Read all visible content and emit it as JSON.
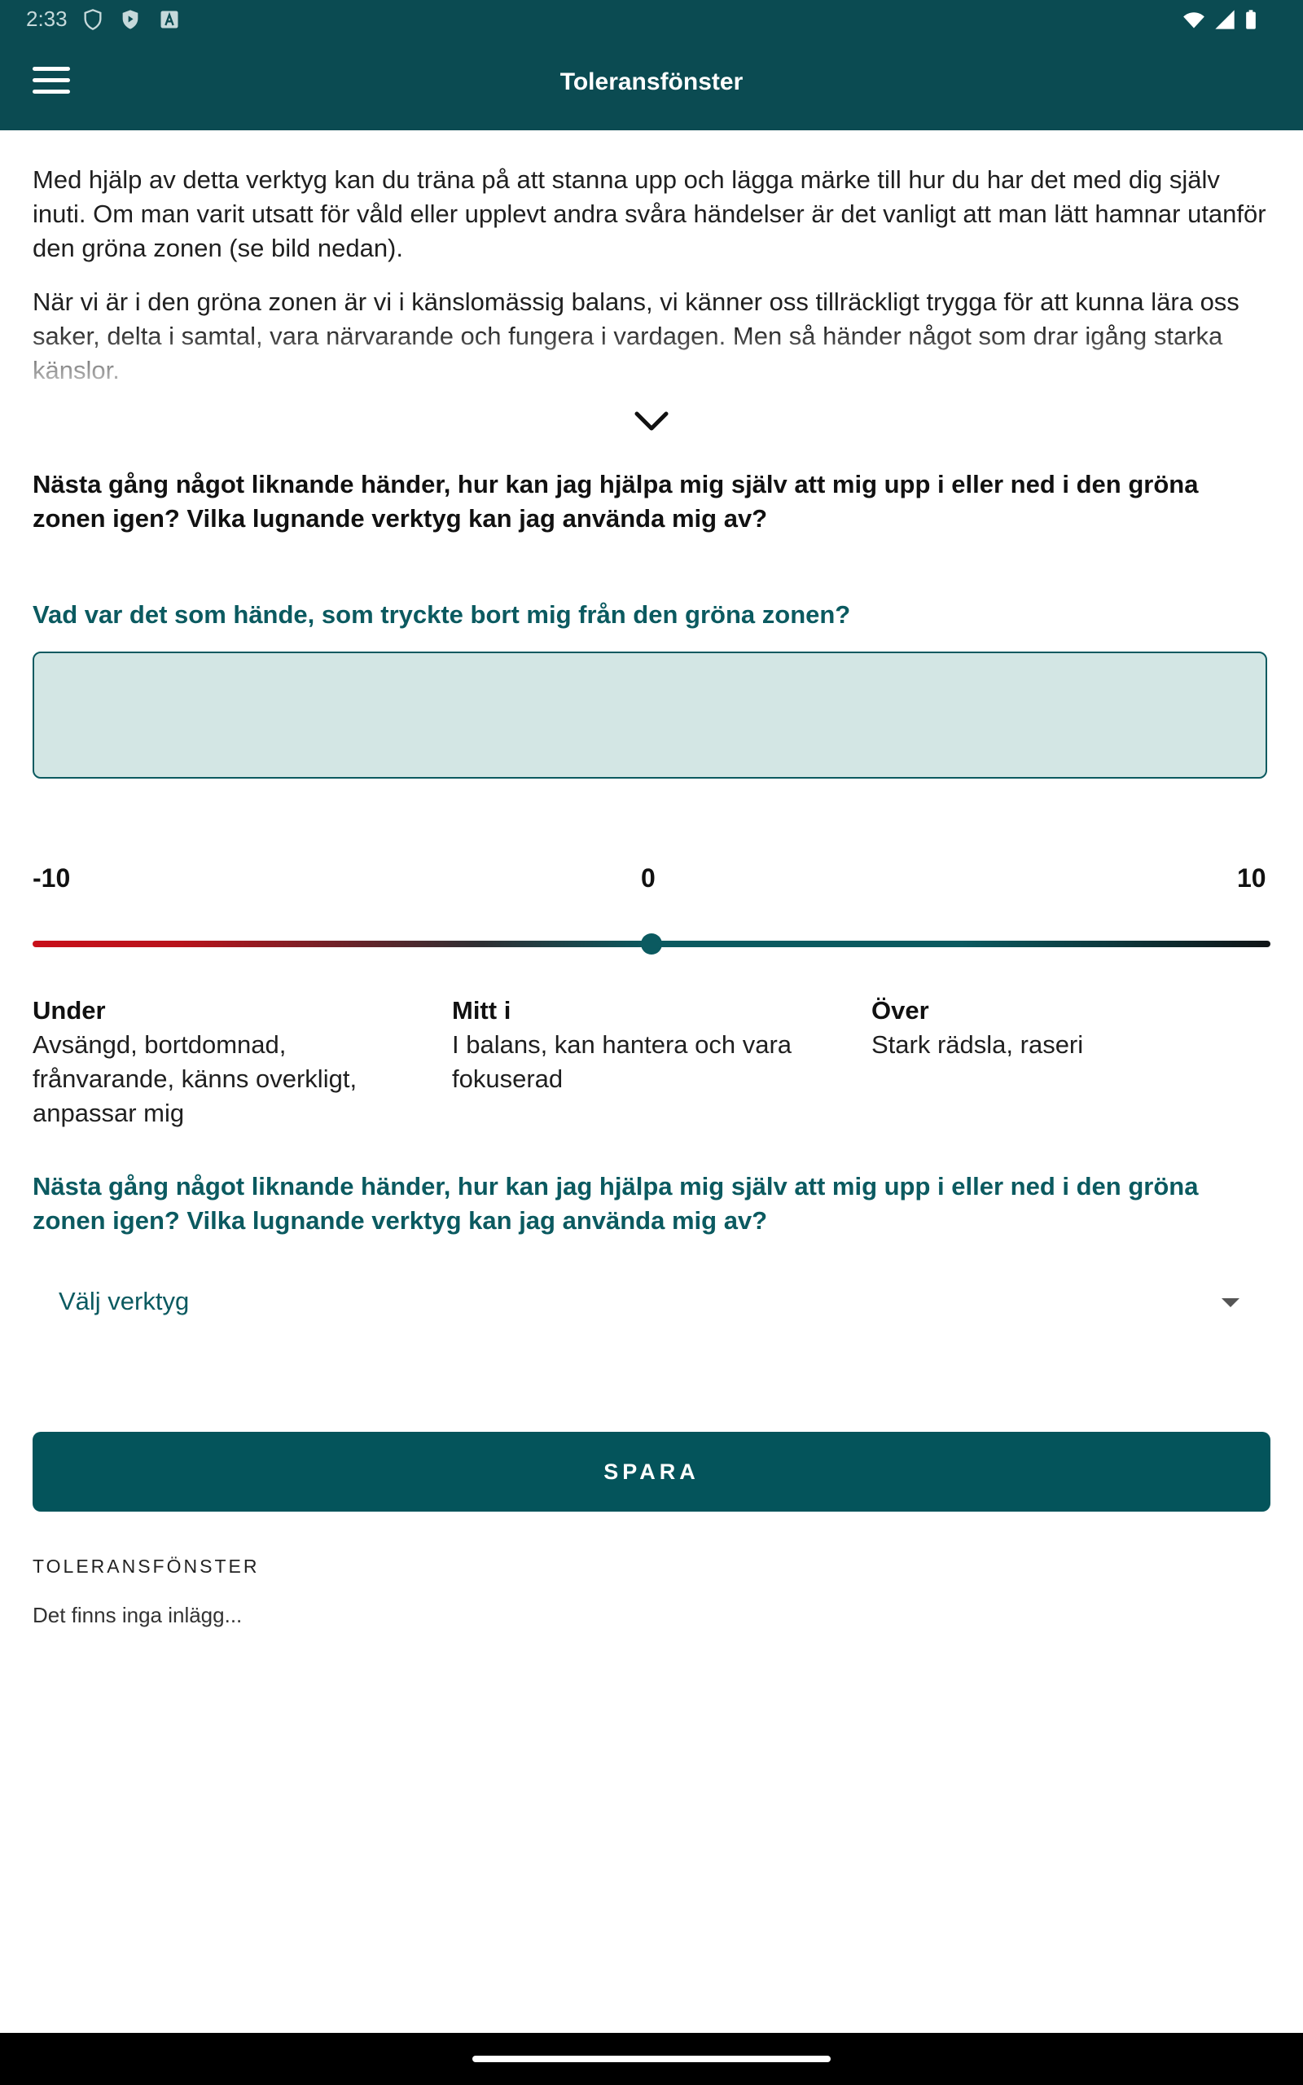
{
  "status_bar": {
    "time": "2:33",
    "icons": [
      "shield-icon",
      "play-protect-icon",
      "text-a-icon",
      "wifi-icon",
      "signal-icon",
      "battery-icon"
    ]
  },
  "app_bar": {
    "title": "Toleransfönster",
    "menu_icon": "hamburger-menu-icon"
  },
  "intro": {
    "paragraph1": "Med hjälp av detta verktyg kan du träna på att stanna upp och lägga märke till hur du har det med dig själv inuti. Om man varit utsatt för våld eller upplevt andra svåra händelser är det vanligt att man lätt hamnar utanför den gröna zonen (se bild nedan).",
    "paragraph2": "När vi är i den gröna zonen är vi i känslomässig balans, vi känner oss tillräckligt trygga för att kunna lära oss saker, delta i samtal, vara närvarande och fungera i vardagen. Men så händer något som drar igång starka känslor.",
    "expand_icon": "chevron-down-icon"
  },
  "prompt_bold": "Nästa gång något liknande händer, hur kan jag hjälpa mig själv att mig upp i eller ned i den gröna zonen igen? Vilka lugnande verktyg kan jag använda mig av?",
  "question1": "Vad var det som hände, som tryckte bort mig från den gröna zonen?",
  "question1_value": "",
  "scale": {
    "min_label": "-10",
    "mid_label": "0",
    "max_label": "10",
    "value": 0,
    "colors": {
      "low": "#c8101a",
      "mid": "#0b5a60",
      "high": "#101416"
    }
  },
  "legend": [
    {
      "title": "Under",
      "desc": "Avsängd, bortdomnad, frånvarande, känns overkligt, anpassar mig"
    },
    {
      "title": "Mitt i",
      "desc": "I balans, kan hantera och vara fokuserad"
    },
    {
      "title": "Över",
      "desc": "Stark rädsla, raseri"
    }
  ],
  "question2": "Nästa gång något liknande händer, hur kan jag hjälpa mig själv att mig upp i eller ned i den gröna zonen igen? Vilka lugnande verktyg kan jag använda mig av?",
  "tool_select": {
    "selected": "Välj verktyg"
  },
  "save_button": "SPARA",
  "entries": {
    "section_title": "TOLERANSFÖNSTER",
    "empty_text": "Det finns inga inlägg..."
  },
  "theme": {
    "primary": "#0b4b52",
    "accent": "#0b5a60",
    "input_bg": "#d3e6e4"
  }
}
